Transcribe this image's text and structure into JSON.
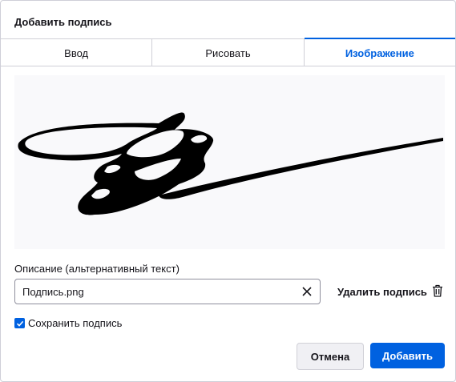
{
  "dialog": {
    "title": "Добавить подпись"
  },
  "tabs": [
    {
      "label": "Ввод",
      "active": false
    },
    {
      "label": "Рисовать",
      "active": false
    },
    {
      "label": "Изображение",
      "active": true
    }
  ],
  "description": {
    "label": "Описание (альтернативный текст)",
    "value": "Подпись.png"
  },
  "delete_button": {
    "label": "Удалить подпись",
    "icon": "trash-icon"
  },
  "save_signature": {
    "label": "Сохранить подпись",
    "checked": true
  },
  "buttons": {
    "cancel": "Отмена",
    "add": "Добавить"
  },
  "colors": {
    "accent": "#0061e0",
    "ink": "#15141a"
  }
}
